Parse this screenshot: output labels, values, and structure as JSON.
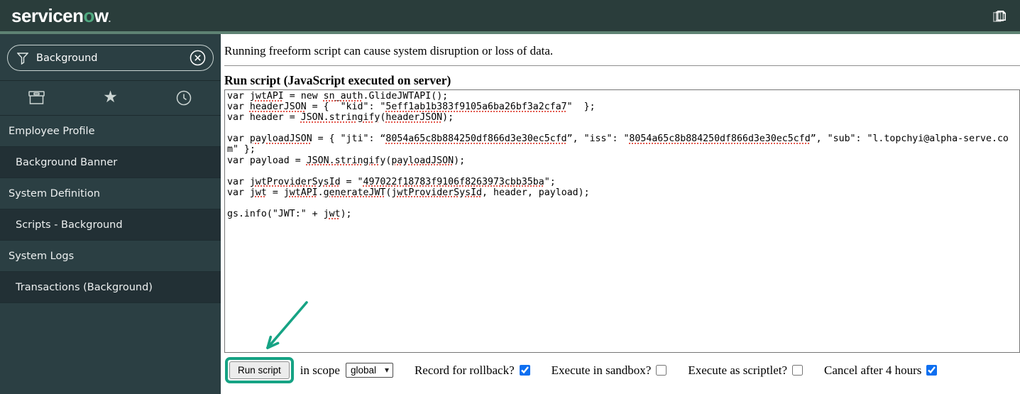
{
  "header": {
    "logo": {
      "pre": "servicen",
      "o": "o",
      "post": "w",
      "dot": "."
    },
    "logo_green": "#4fa87f",
    "icons": {
      "top_right": "copy-pages-icon"
    }
  },
  "sidebar": {
    "search": {
      "value": "Background",
      "left_icon": "filter-funnel-icon",
      "right_icon": "clear-circle-x-icon"
    },
    "tabs": [
      {
        "name": "all-applications",
        "icon": "box-icon"
      },
      {
        "name": "favorites",
        "icon": "star-icon"
      },
      {
        "name": "history",
        "icon": "clock-icon"
      }
    ],
    "items": [
      {
        "label": "Employee Profile",
        "level": "section"
      },
      {
        "label": "Background Banner",
        "level": "child"
      },
      {
        "label": "System Definition",
        "level": "section"
      },
      {
        "label": "Scripts - Background",
        "level": "child"
      },
      {
        "label": "System Logs",
        "level": "section"
      },
      {
        "label": "Transactions (Background)",
        "level": "child"
      }
    ]
  },
  "main": {
    "warning": "Running freeform script can cause system disruption or loss of data.",
    "heading": "Run script (JavaScript executed on server)",
    "editor": {
      "code": "var jwtAPI = new sn_auth.GlideJWTAPI();\nvar headerJSON = {  \"kid\": \"5eff1ab1b383f9105a6ba26bf3a2cfa7\"  };\nvar header = JSON.stringify(headerJSON);\n\nvar payloadJSON = { \"jti\": “8054a65c8b884250df866d3e30ec5cfd”, \"iss\": \"8054a65c8b884250df866d3e30ec5cfd”, \"sub\": \"l.topchyi@alpha-serve.com\" };\nvar payload = JSON.stringify(payloadJSON);\n\nvar jwtProviderSysId = \"497022f18783f9106f8263973cbb35ba\";\nvar jwt = jwtAPI.generateJWT(jwtProviderSysId, header, payload);\n\ngs.info(\"JWT:\" + jwt);",
      "misspelled_tokens": [
        "jwtProviderSysId",
        "497022f18783f9106f8263973cbb35ba",
        "8054a65c8b884250df866d3e30ec5cfd",
        "5eff1ab1b383f9105a6ba26bf3a2cfa7",
        "JSON.stringify",
        "payloadJSON",
        "headerJSON",
        "generateJWT",
        "sn_auth",
        "jwtAPI",
        "jwt"
      ]
    },
    "controls": {
      "run_button_label": "Run script",
      "scope_label": "in scope",
      "scope_selected": "global",
      "checkboxes": [
        {
          "label": "Record for rollback?",
          "checked": true
        },
        {
          "label": "Execute in sandbox?",
          "checked": false
        },
        {
          "label": "Execute as scriptlet?",
          "checked": false
        },
        {
          "label": "Cancel after 4 hours",
          "checked": true
        }
      ]
    },
    "annotation": {
      "color": "#16a384",
      "target": "Run script button",
      "shapes": [
        "arrow",
        "highlight-box"
      ]
    }
  }
}
